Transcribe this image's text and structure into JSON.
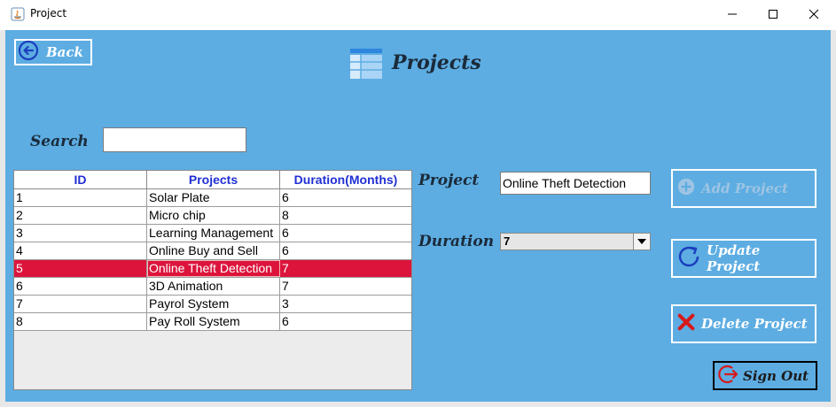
{
  "window": {
    "title": "Project"
  },
  "header": {
    "back_label": "Back",
    "title": "Projects"
  },
  "search": {
    "label": "Search",
    "value": ""
  },
  "table": {
    "columns": [
      "ID",
      "Projects",
      "Duration(Months)"
    ],
    "rows": [
      [
        "1",
        "Solar Plate",
        "6"
      ],
      [
        "2",
        "Micro chip",
        "8"
      ],
      [
        "3",
        "Learning Management",
        "6"
      ],
      [
        "4",
        "Online Buy and Sell",
        "6"
      ],
      [
        "5",
        "Online Theft Detection",
        "7"
      ],
      [
        "6",
        "3D Animation",
        "7"
      ],
      [
        "7",
        "Payrol System",
        "3"
      ],
      [
        "8",
        "Pay Roll System",
        "6"
      ]
    ],
    "selected_row": 5
  },
  "form": {
    "project_label": "Project",
    "project_value": "Online Theft Detection",
    "duration_label": "Duration",
    "duration_value": "7"
  },
  "actions": {
    "add_label": "Add Project",
    "update_label": "Update Project",
    "delete_label": "Delete Project",
    "signout_label": "Sign Out"
  },
  "colors": {
    "background": "#5dade2",
    "selection": "#dc143c",
    "header_text": "#1f2fd3"
  }
}
